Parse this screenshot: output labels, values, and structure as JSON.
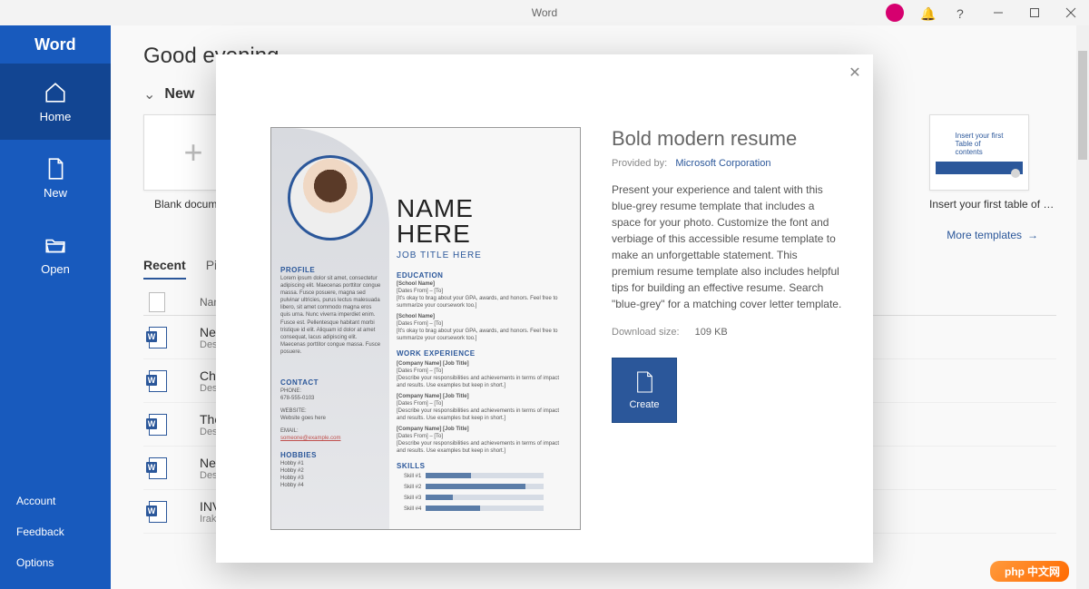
{
  "titlebar": {
    "appname": "Word"
  },
  "sidebar": {
    "logo": "Word",
    "items": [
      {
        "label": "Home"
      },
      {
        "label": "New"
      },
      {
        "label": "Open"
      }
    ],
    "bottom": [
      {
        "label": "Account"
      },
      {
        "label": "Feedback"
      },
      {
        "label": "Options"
      }
    ]
  },
  "main": {
    "greeting": "Good evening",
    "section_new": "New",
    "templates": [
      {
        "caption": "Blank document"
      },
      {
        "caption": "Insert your first table of cont…",
        "thumb_text": "Insert your first\nTable of\ncontents"
      }
    ],
    "more_templates": "More templates",
    "tabs": [
      {
        "label": "Recent",
        "active": true
      },
      {
        "label": "Pinned"
      }
    ],
    "file_header": {
      "col_name": "Name"
    },
    "files": [
      {
        "name": "New M…",
        "loc": "Desktop",
        "icon": "word"
      },
      {
        "name": "Chang…",
        "loc": "Desktop",
        "icon": "word"
      },
      {
        "name": "Thegrn…",
        "loc": "Desktop",
        "icon": "word"
      },
      {
        "name": "New F…",
        "loc": "Desktop",
        "icon": "word"
      },
      {
        "name": "INVOI…",
        "loc": "Irakli Cl…",
        "icon": "word"
      }
    ]
  },
  "modal": {
    "title": "Bold modern resume",
    "provided_label": "Provided by:",
    "provider": "Microsoft Corporation",
    "description": "Present your experience and talent with this blue-grey resume template that includes a space for your photo. Customize the font and verbiage of this accessible resume template to make an unforgettable statement. This premium resume template also includes helpful tips for building an effective resume. Search \"blue-grey\" for a matching cover letter template.",
    "download_label": "Download size:",
    "download_size": "109 KB",
    "create_label": "Create",
    "preview": {
      "name": "NAME\nHERE",
      "jobtitle": "JOB TITLE HERE",
      "profile": "PROFILE",
      "contact": "CONTACT",
      "hobbies": "HOBBIES",
      "education": "EDUCATION",
      "work": "WORK EXPERIENCE",
      "skills": "SKILLS",
      "phone_label": "PHONE:",
      "phone": "678-555-0103",
      "website_label": "WEBSITE:",
      "website": "Website goes here",
      "email_label": "EMAIL:",
      "email": "someone@example.com",
      "hobby_items": [
        "Hobby #1",
        "Hobby #2",
        "Hobby #3",
        "Hobby #4"
      ],
      "skill_items": [
        "Skill #1",
        "Skill #2",
        "Skill #3",
        "Skill #4"
      ],
      "school": "[School Name]",
      "dates": "[Dates From] – [To]",
      "school_note": "[It's okay to brag about your GPA, awards, and honors. Feel free to summarize your coursework too.]",
      "company": "[Company Name]  [Job Title]",
      "company_note": "[Describe your responsibilities and achievements in terms of impact and results. Use examples but keep in short.]",
      "lorem": "Lorem ipsum dolor sit amet, consectetur adipiscing elit. Maecenas porttitor congue massa. Fusce posuere, magna sed pulvinar ultricies, purus lectus malesuada libero, sit amet commodo magna eros quis urna. Nunc viverra imperdiet enim. Fusce est. Pellentesque habitant morbi tristique id elit. Aliquam id dolor at amet consequat, lacus adipiscing elit. Maecenas porttitor congue massa. Fusce posuere."
    }
  },
  "watermark": "中文网"
}
